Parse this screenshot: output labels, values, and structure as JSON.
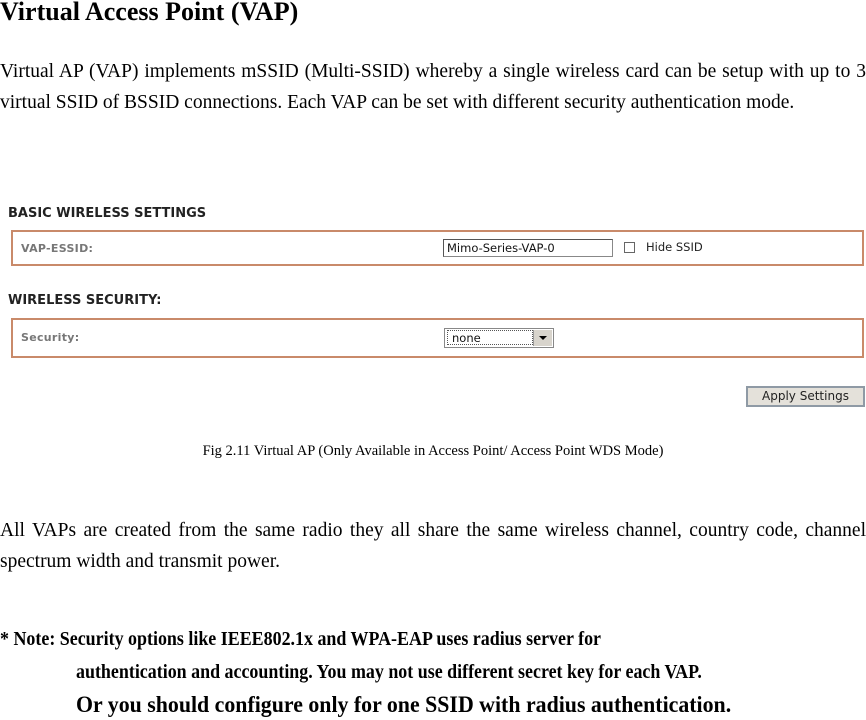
{
  "heading": "Virtual Access Point (VAP)",
  "intro": "Virtual AP (VAP) implements mSSID (Multi-SSID) whereby a single wireless card can be setup with up to 3 virtual SSID of BSSID connections. Each VAP can be set with different security authentication mode.",
  "figure": {
    "basic_section_title": "BASIC WIRELESS SETTINGS",
    "essid_label": "VAP-ESSID:",
    "essid_value": "Mimo-Series-VAP-0",
    "hide_ssid_label": "Hide SSID",
    "hide_ssid_checked": false,
    "security_section_title": "WIRELESS SECURITY:",
    "security_label": "Security:",
    "security_value": "none",
    "apply_button": "Apply Settings",
    "caption": "Fig 2.11 Virtual AP (Only Available in Access Point/ Access Point WDS Mode)"
  },
  "body_text": "All VAPs are created from the same radio they all share the same wireless channel, country code, channel spectrum width and transmit power.",
  "note": {
    "line1": "* Note: Security options like IEEE802.1x and WPA-EAP uses radius server for",
    "line2": "authentication and accounting. You may not use different secret key for each VAP.",
    "line3": "Or you should configure only for one SSID with radius authentication."
  }
}
